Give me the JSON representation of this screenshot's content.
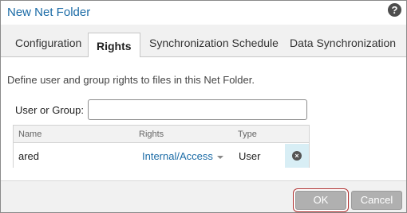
{
  "dialog": {
    "title": "New Net Folder",
    "help_symbol": "?"
  },
  "tabs": [
    {
      "label": "Configuration",
      "active": false
    },
    {
      "label": "Rights",
      "active": true
    },
    {
      "label": "Synchronization Schedule",
      "active": false
    },
    {
      "label": "Data Synchronization",
      "active": false
    }
  ],
  "rights": {
    "description": "Define user and group rights to files in this Net Folder.",
    "user_group_label": "User or Group:",
    "user_group_value": "",
    "columns": {
      "name": "Name",
      "rights": "Rights",
      "type": "Type"
    },
    "rows": [
      {
        "name": "ared",
        "rights": "Internal/Access",
        "type": "User",
        "remove_symbol": "×"
      }
    ]
  },
  "footer": {
    "ok_label": "OK",
    "cancel_label": "Cancel"
  },
  "colors": {
    "title": "#1b6ba6",
    "link": "#1b6ba6",
    "button": "#b0b0b0",
    "focus_ring": "#b03030"
  },
  "icons": {
    "help": "help-icon",
    "remove": "remove-icon",
    "dropdown": "caret-down-icon"
  }
}
